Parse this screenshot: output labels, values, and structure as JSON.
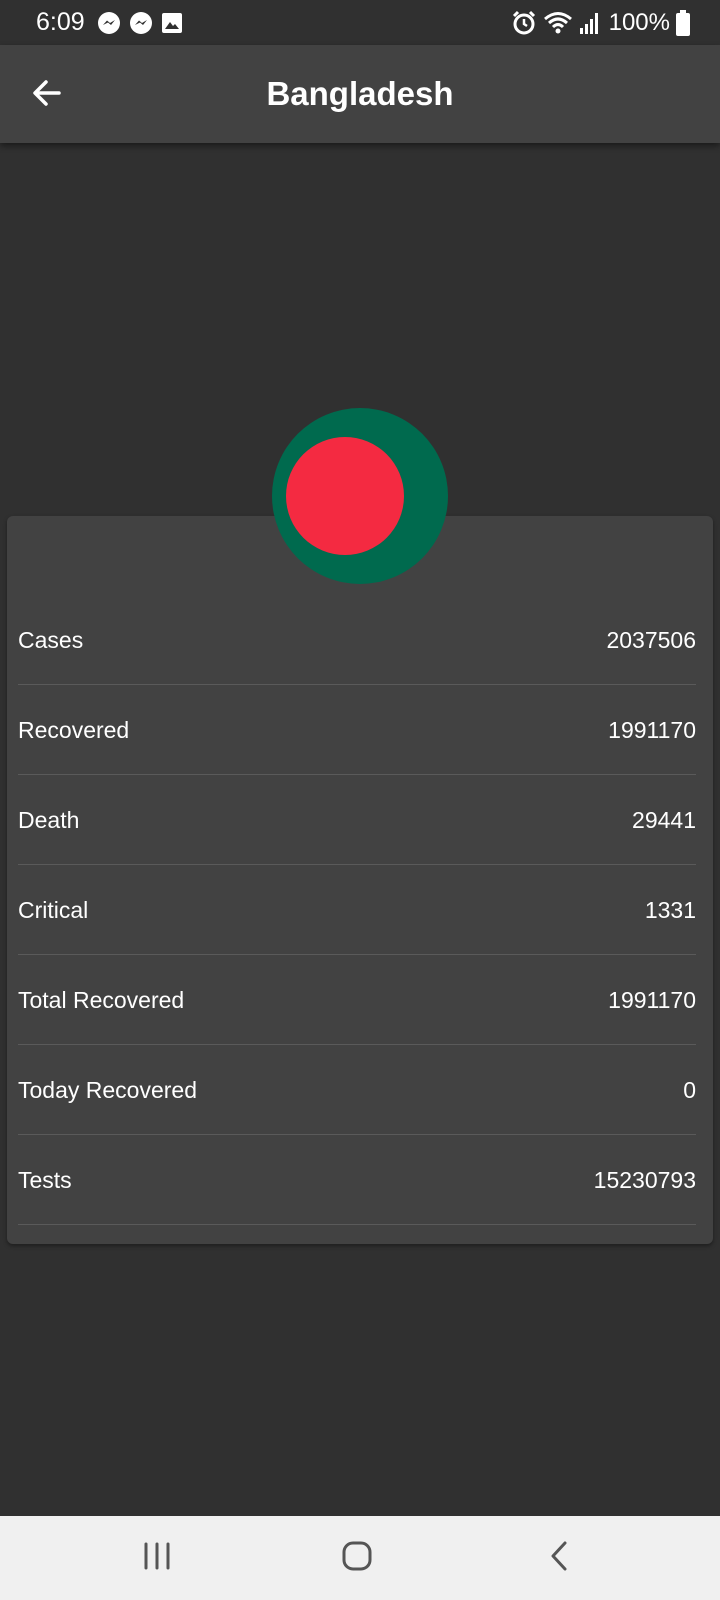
{
  "status_bar": {
    "time": "6:09",
    "battery_text": "100%",
    "left_icons": [
      "messenger-icon",
      "messenger-icon",
      "gallery-icon"
    ],
    "right_icons": [
      "alarm-icon",
      "wifi-icon",
      "signal-icon",
      "battery-icon"
    ]
  },
  "app_bar": {
    "title": "Bangladesh",
    "back_icon": "arrow-back-icon"
  },
  "flag": {
    "country": "Bangladesh",
    "field_color": "#006a4e",
    "disc_color": "#f42a41"
  },
  "stats": [
    {
      "label": "Cases",
      "value": "2037506"
    },
    {
      "label": "Recovered",
      "value": "1991170"
    },
    {
      "label": "Death",
      "value": "29441"
    },
    {
      "label": "Critical",
      "value": "1331"
    },
    {
      "label": "Total Recovered",
      "value": "1991170"
    },
    {
      "label": "Today Recovered",
      "value": "0"
    },
    {
      "label": "Tests",
      "value": "15230793"
    }
  ],
  "nav_bar": {
    "icons": [
      "recent-apps-icon",
      "home-icon",
      "back-icon"
    ]
  },
  "colors": {
    "background": "#303030",
    "surface": "#424242",
    "divider": "#5a5a5a",
    "nav_background": "#f0f0f0"
  }
}
